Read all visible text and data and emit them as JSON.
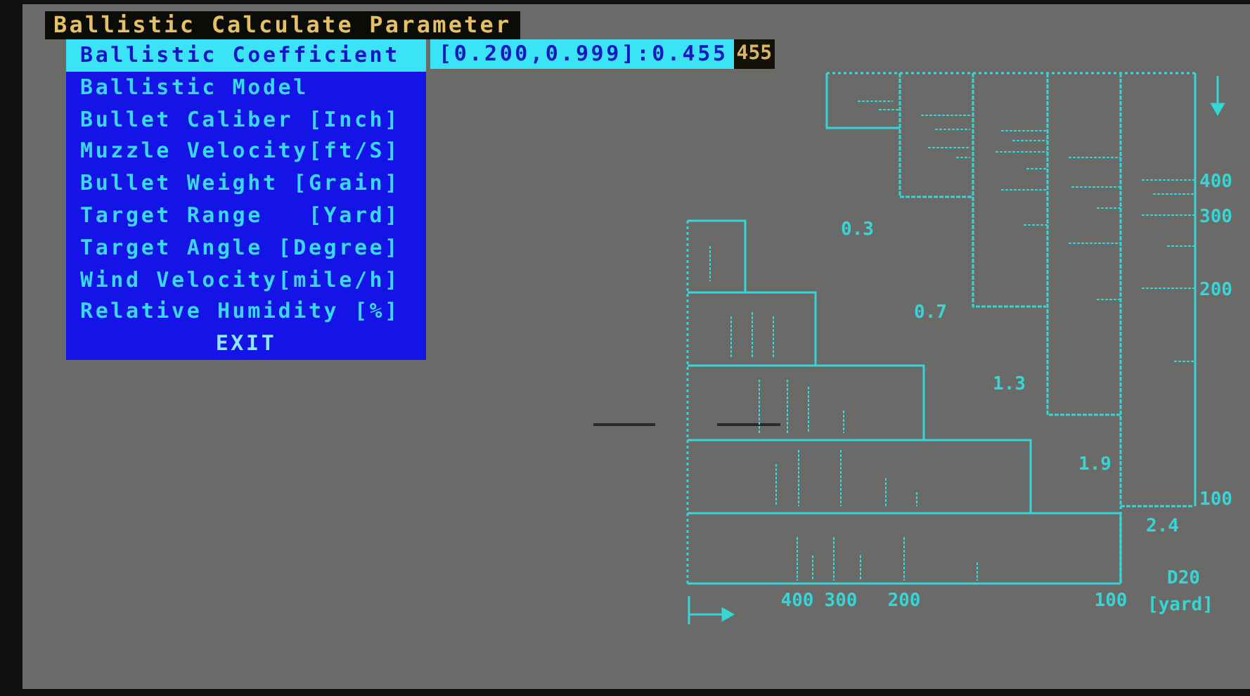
{
  "title": "Ballistic Calculate Parameter",
  "menu": [
    {
      "label": "Ballistic Coefficient",
      "kind": "param",
      "selected": true
    },
    {
      "label": "Ballistic Model",
      "kind": "param",
      "selected": false
    },
    {
      "label": "Bullet Caliber [Inch]",
      "kind": "param",
      "selected": false
    },
    {
      "label": "Muzzle Velocity[ft/S]",
      "kind": "param",
      "selected": false
    },
    {
      "label": "Bullet Weight [Grain]",
      "kind": "param",
      "selected": false
    },
    {
      "label": "Target Range   [Yard]",
      "kind": "param",
      "selected": false
    },
    {
      "label": "Target Angle [Degree]",
      "kind": "param",
      "selected": false
    },
    {
      "label": "Wind Velocity[mile/h]",
      "kind": "param",
      "selected": false
    },
    {
      "label": "Relative Humidity [%]",
      "kind": "param",
      "selected": false
    },
    {
      "label": "EXIT",
      "kind": "action",
      "selected": false
    }
  ],
  "value_field": "[0.200,0.999]:0.455",
  "value_box": "455",
  "diagram": {
    "drop_labels": [
      "0.3",
      "0.7",
      "1.3",
      "1.9",
      "2.4"
    ],
    "x_labels": [
      "400",
      "300",
      "200",
      "100"
    ],
    "y_labels": [
      "400",
      "300",
      "200",
      "100"
    ],
    "model": "D20",
    "unit": "[yard]"
  }
}
